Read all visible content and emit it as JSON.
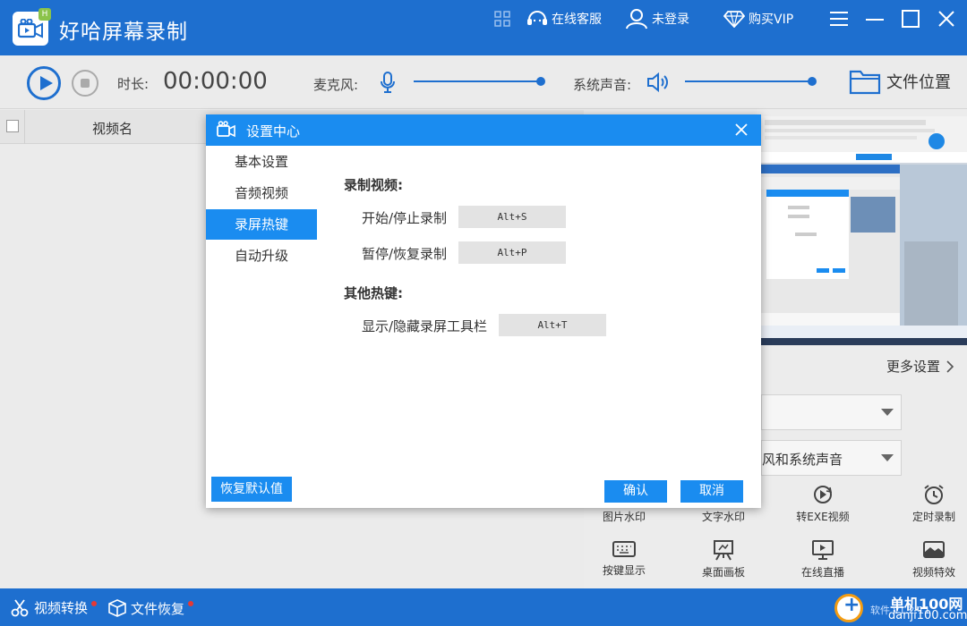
{
  "app": {
    "title": "好哈屏幕录制",
    "badge": "H",
    "online_service": "在线客服",
    "login": "未登录",
    "buy_vip": "购买VIP"
  },
  "toolbar": {
    "duration_label": "时长:",
    "duration_value": "00:00:00",
    "mic_label": "麦克风:",
    "system_sound_label": "系统声音:",
    "file_location": "文件位置",
    "mic_volume": 1.0,
    "system_volume": 1.0
  },
  "list": {
    "column_name": "视频名"
  },
  "right_panel": {
    "more_settings": "更多设置",
    "audio_source_value": "风和系统声音",
    "tools": [
      {
        "label": "图片水印",
        "icon": "image-watermark-icon"
      },
      {
        "label": "文字水印",
        "icon": "text-watermark-icon"
      },
      {
        "label": "转EXE视频",
        "icon": "convert-exe-icon"
      },
      {
        "label": "定时录制",
        "icon": "alarm-clock-icon"
      },
      {
        "label": "按键显示",
        "icon": "keyboard-icon"
      },
      {
        "label": "桌面画板",
        "icon": "easel-icon"
      },
      {
        "label": "在线直播",
        "icon": "live-stream-icon"
      },
      {
        "label": "视频特效",
        "icon": "video-effects-icon"
      }
    ]
  },
  "bottom": {
    "video_convert": "视频转换",
    "file_recover": "文件恢复",
    "watermark_title": "单机100网",
    "watermark_url": "danji100.com",
    "version": "软件 v1.2.11"
  },
  "dialog": {
    "title": "设置中心",
    "nav": [
      "基本设置",
      "音频视频",
      "录屏热键",
      "自动升级"
    ],
    "active_nav": "录屏热键",
    "section_record": "录制视频:",
    "start_stop_label": "开始/停止录制",
    "start_stop_key": "Alt+S",
    "pause_resume_label": "暂停/恢复录制",
    "pause_resume_key": "Alt+P",
    "section_other": "其他热键:",
    "toggle_toolbar_label": "显示/隐藏录屏工具栏",
    "toggle_toolbar_key": "Alt+T",
    "restore_defaults": "恢复默认值",
    "confirm": "确认",
    "cancel": "取消"
  },
  "colors": {
    "primary": "#1e6fcf",
    "dialog_accent": "#1a8cf0",
    "notify_dot": "#e53935"
  }
}
